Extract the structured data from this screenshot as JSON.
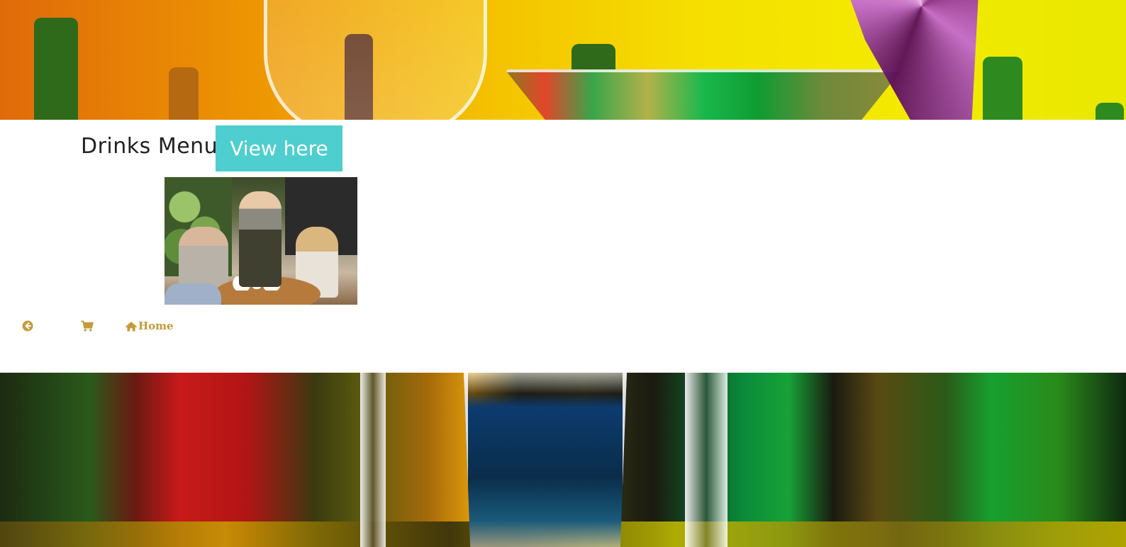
{
  "page": {
    "menu_title": "Drinks Menu",
    "view_button_label": "View here"
  },
  "images": {
    "top_banner": "cocktail-glasses-banner",
    "photo": "waitress-taking-order-photo",
    "bottom_banner": "shot-glass-bar-banner"
  },
  "nav": {
    "back_icon": "arrow-circle-left-icon",
    "cart_icon": "shopping-cart-icon",
    "home_icon": "home-icon",
    "home_label": "Home"
  },
  "colors": {
    "accent_button": "#4ecece",
    "nav_link": "#c59a3a",
    "title_text": "#222222"
  }
}
